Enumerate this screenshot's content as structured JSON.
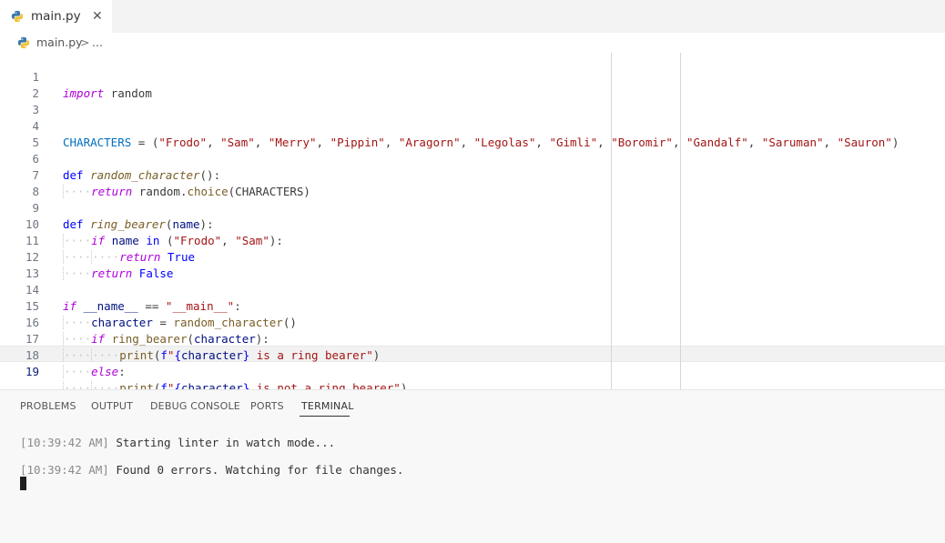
{
  "tab": {
    "label": "main.py",
    "close_glyph": "✕",
    "icon": "python-icon"
  },
  "breadcrumb": {
    "file": "main.py",
    "separator": ">",
    "more": "..."
  },
  "editor": {
    "active_line": 19,
    "lines": [
      {
        "n": "1"
      },
      {
        "n": "2"
      },
      {
        "n": "3"
      },
      {
        "n": "4"
      },
      {
        "n": "5"
      },
      {
        "n": "6"
      },
      {
        "n": "7"
      },
      {
        "n": "8"
      },
      {
        "n": "9"
      },
      {
        "n": "10"
      },
      {
        "n": "11"
      },
      {
        "n": "12"
      },
      {
        "n": "13"
      },
      {
        "n": "14"
      },
      {
        "n": "15"
      },
      {
        "n": "16"
      },
      {
        "n": "17"
      },
      {
        "n": "18"
      },
      {
        "n": "19"
      }
    ],
    "tokens": {
      "import": "import",
      "random": "random",
      "characters": "CHARACTERS",
      "eq": " = ",
      "lp": "(",
      "rp": ")",
      "comma": ", ",
      "names": [
        "\"Frodo\"",
        "\"Sam\"",
        "\"Merry\"",
        "\"Pippin\"",
        "\"Aragorn\"",
        "\"Legolas\"",
        "\"Gimli\"",
        "\"Boromir\"",
        "\"Gandalf\"",
        "\"Saruman\"",
        "\"Sauron\""
      ],
      "def": "def",
      "random_character": "random_character",
      "parens_colon": "():",
      "return": "return",
      "random_dot": "random.",
      "choice": "choice",
      "characters_arg": "(CHARACTERS)",
      "ring_bearer": "ring_bearer",
      "name_param": "name",
      "colon": "):",
      "if": "if",
      "name": "name",
      "in": "in",
      "frodo": "\"Frodo\"",
      "sam": "\"Sam\"",
      "true": "True",
      "false": "False",
      "dunder_name": "__name__",
      "eqeq": " == ",
      "dunder_main": "\"__main__\"",
      "colon_only": ":",
      "character": "character",
      "call_rc": "random_character",
      "call_parens": "()",
      "call_rb": "ring_bearer",
      "arg_character": "character",
      "print": "print",
      "f": "f",
      "q": "\"",
      "lb": "{",
      "rb": "}",
      "is_bearer": " is a ring bearer",
      "is_not_bearer": " is not a ring bearer",
      "else": "else"
    }
  },
  "panel": {
    "tabs": [
      "PROBLEMS",
      "OUTPUT",
      "DEBUG CONSOLE",
      "PORTS",
      "TERMINAL"
    ],
    "active_tab": "TERMINAL",
    "terminal": [
      {
        "timestamp": "[10:39:42 AM]",
        "message": " Starting linter in watch mode..."
      },
      {
        "timestamp": "[10:39:42 AM]",
        "message": " Found 0 errors. Watching for file changes."
      }
    ]
  },
  "colors": {
    "keyword": "#af00db",
    "function": "#795e26",
    "string": "#a31515",
    "constant": "#0070c1",
    "variable": "#001080"
  }
}
